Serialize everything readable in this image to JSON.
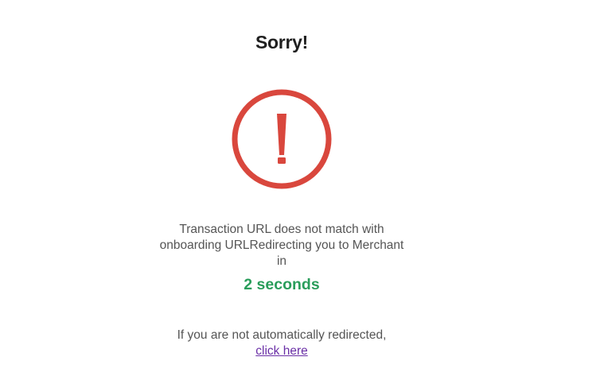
{
  "page": {
    "title": "Sorry!",
    "message": "Transaction URL does not match with onboarding URLRedirecting you to Merchant in",
    "countdown": "2 seconds",
    "redirect_prefix": "If you are not automatically redirected, ",
    "redirect_link_label": "click here"
  },
  "icon": {
    "name": "exclamation-circle-icon",
    "color": "#d9473d"
  },
  "colors": {
    "countdown": "#2a9d5b",
    "link": "#6a2fa6"
  }
}
